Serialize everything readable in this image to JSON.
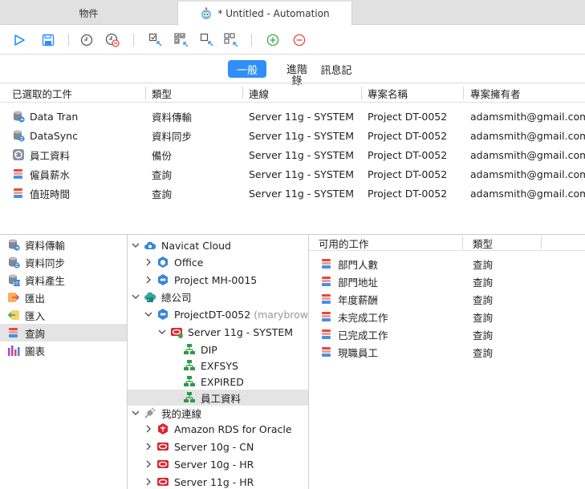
{
  "tabs": {
    "objects": "物件",
    "automation": "* Untitled - Automation"
  },
  "toolbar": {
    "icons": [
      "run-icon",
      "save-icon",
      "schedule-icon",
      "remove-schedule-icon",
      "select-icon",
      "select-all-icon",
      "deselect-icon",
      "deselect-all-icon",
      "add-icon",
      "remove-icon"
    ]
  },
  "segments": {
    "general": "一般",
    "advanced_line1": "進階",
    "advanced_line2": "錄",
    "log": "訊息記"
  },
  "jobs_table": {
    "headers": [
      "已選取的工件",
      "類型",
      "連線",
      "專案名稱",
      "專案擁有者"
    ],
    "rows": [
      {
        "name": "Data Tran",
        "type": "資料傳輸",
        "connection": "Server 11g - SYSTEM",
        "project": "Project DT-0052",
        "owner": "adamsmith@gmail.com",
        "icon": "data-transfer-icon"
      },
      {
        "name": "DataSync",
        "type": "資料同步",
        "connection": "Server 11g - SYSTEM",
        "project": "Project DT-0052",
        "owner": "adamsmith@gmail.com",
        "icon": "data-sync-icon"
      },
      {
        "name": "員工資料",
        "type": "備份",
        "connection": "Server 11g - SYSTEM",
        "project": "Project DT-0052",
        "owner": "adamsmith@gmail.com",
        "icon": "backup-icon"
      },
      {
        "name": "僱員薪水",
        "type": "查詢",
        "connection": "Server 11g - SYSTEM",
        "project": "Project DT-0052",
        "owner": "adamsmith@gmail.com",
        "icon": "query-icon"
      },
      {
        "name": "值班時間",
        "type": "查詢",
        "connection": "Server 11g - SYSTEM",
        "project": "Project DT-0052",
        "owner": "adamsmith@gmail.com",
        "icon": "query-icon"
      }
    ]
  },
  "job_types": [
    {
      "label": "資料傳輸",
      "icon": "data-transfer-icon"
    },
    {
      "label": "資料同步",
      "icon": "data-sync-icon"
    },
    {
      "label": "資料產生",
      "icon": "data-generation-icon"
    },
    {
      "label": "匯出",
      "icon": "export-icon"
    },
    {
      "label": "匯入",
      "icon": "import-icon"
    },
    {
      "label": "查詢",
      "icon": "query-icon",
      "selected": true
    },
    {
      "label": "圖表",
      "icon": "chart-icon"
    }
  ],
  "tree": {
    "navicat_cloud": "Navicat Cloud",
    "office": "Office",
    "project_mh": "Project MH-0015",
    "head_office": "總公司",
    "project_dt": "ProjectDT-0052",
    "project_dt_owner": "(marybrown...",
    "server_11g_system": "Server 11g - SYSTEM",
    "schema_dip": "DIP",
    "schema_exfsys": "EXFSYS",
    "schema_expired": "EXPIRED",
    "schema_employee": "員工資料",
    "my_connections": "我的連線",
    "amazon_rds": "Amazon RDS for Oracle",
    "server_10g_cn": "Server 10g - CN",
    "server_10g_hr": "Server 10g - HR",
    "server_11g_hr": "Server 11g - HR"
  },
  "available_jobs": {
    "headers": [
      "可用的工作",
      "類型"
    ],
    "rows": [
      {
        "name": "部門人數",
        "type": "查詢"
      },
      {
        "name": "部門地址",
        "type": "查詢"
      },
      {
        "name": "年度薪酬",
        "type": "查詢"
      },
      {
        "name": "未完成工作",
        "type": "查詢"
      },
      {
        "name": "已完成工作",
        "type": "查詢"
      },
      {
        "name": "現職員工",
        "type": "查詢"
      }
    ]
  },
  "colors": {
    "accent": "#2f8ff6",
    "selected_row": "#e4e4e4",
    "oracle_red": "#d9252f",
    "schema_green": "#2e9a46"
  }
}
